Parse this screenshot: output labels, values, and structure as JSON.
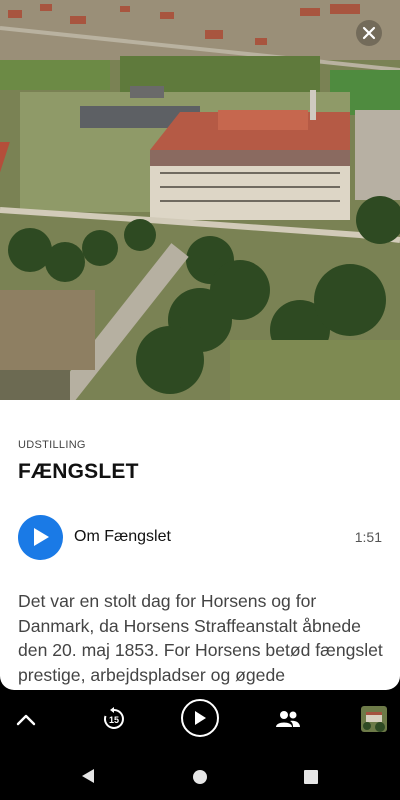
{
  "hero": {
    "image": "aerial photo of Horsens prison",
    "close_icon": "close-icon"
  },
  "exhibit": {
    "category": "UDSTILLING",
    "title": "FÆNGSLET"
  },
  "track": {
    "label": "Om Fængslet",
    "duration": "1:51",
    "play_icon": "play-icon",
    "accent_color": "#1a7ae6"
  },
  "description": "Det var en stolt dag for Horsens og for Danmark, da Horsens Straffeanstalt åbnede den 20. maj 1853. For Horsens betød fængslet prestige, arbejdspladser og øgede",
  "player": {
    "expand_icon": "chevron-up-icon",
    "rewind_icon": "rewind-15-icon",
    "rewind_seconds": "15",
    "play_icon": "play-icon",
    "people_icon": "people-icon",
    "thumbnail": "prison-thumbnail"
  },
  "navbar": {
    "back_icon": "back-triangle-icon",
    "home_icon": "home-circle-icon",
    "recents_icon": "recents-square-icon"
  }
}
